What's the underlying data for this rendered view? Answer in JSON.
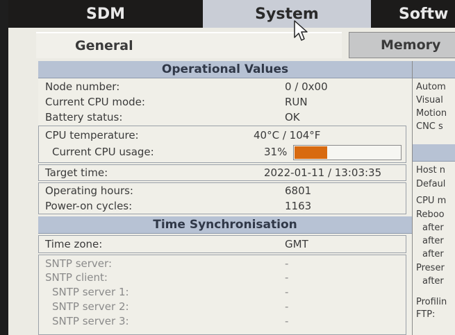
{
  "nav": {
    "tabs": [
      {
        "label": "SDM"
      },
      {
        "label": "System"
      },
      {
        "label": "Softw"
      }
    ],
    "subtabs": [
      {
        "label": "General"
      },
      {
        "label": "Memory"
      }
    ]
  },
  "operational": {
    "title": "Operational Values",
    "node_number": {
      "label": "Node number:",
      "value": "0 / 0x00"
    },
    "cpu_mode": {
      "label": "Current CPU mode:",
      "value": "RUN"
    },
    "battery": {
      "label": "Battery status:",
      "value": "OK"
    },
    "cpu_temp": {
      "label": "CPU temperature:",
      "value": "40°C / 104°F"
    },
    "cpu_usage": {
      "label": "Current CPU usage:",
      "value": "31%",
      "fraction": 0.31
    },
    "target_time": {
      "label": "Target time:",
      "value": "2022-01-11 / 13:03:35"
    },
    "operating_hours": {
      "label": "Operating hours:",
      "value": "6801"
    },
    "power_cycles": {
      "label": "Power-on cycles:",
      "value": "1163"
    }
  },
  "timesync": {
    "title": "Time Synchronisation",
    "time_zone": {
      "label": "Time zone:",
      "value": "GMT"
    },
    "sntp_server": {
      "label": "SNTP server:",
      "value": "-"
    },
    "sntp_client": {
      "label": "SNTP client:",
      "value": "-"
    },
    "sntp_server1": {
      "label": "SNTP server 1:",
      "value": "-"
    },
    "sntp_server2": {
      "label": "SNTP server 2:",
      "value": "-"
    },
    "sntp_server3": {
      "label": "SNTP server 3:",
      "value": "-"
    }
  },
  "right": {
    "items": [
      "Autom",
      "Visual",
      "Motion",
      "CNC s",
      "Host n",
      "Defaul",
      "CPU m",
      "Reboo",
      "after",
      "after",
      "after",
      "Preser",
      "after",
      "Profilin",
      "FTP:"
    ]
  },
  "colors": {
    "accent_usage": "#d86a10",
    "header_bg": "#b7c2d4",
    "tab_dark": "#1c1b1a"
  }
}
